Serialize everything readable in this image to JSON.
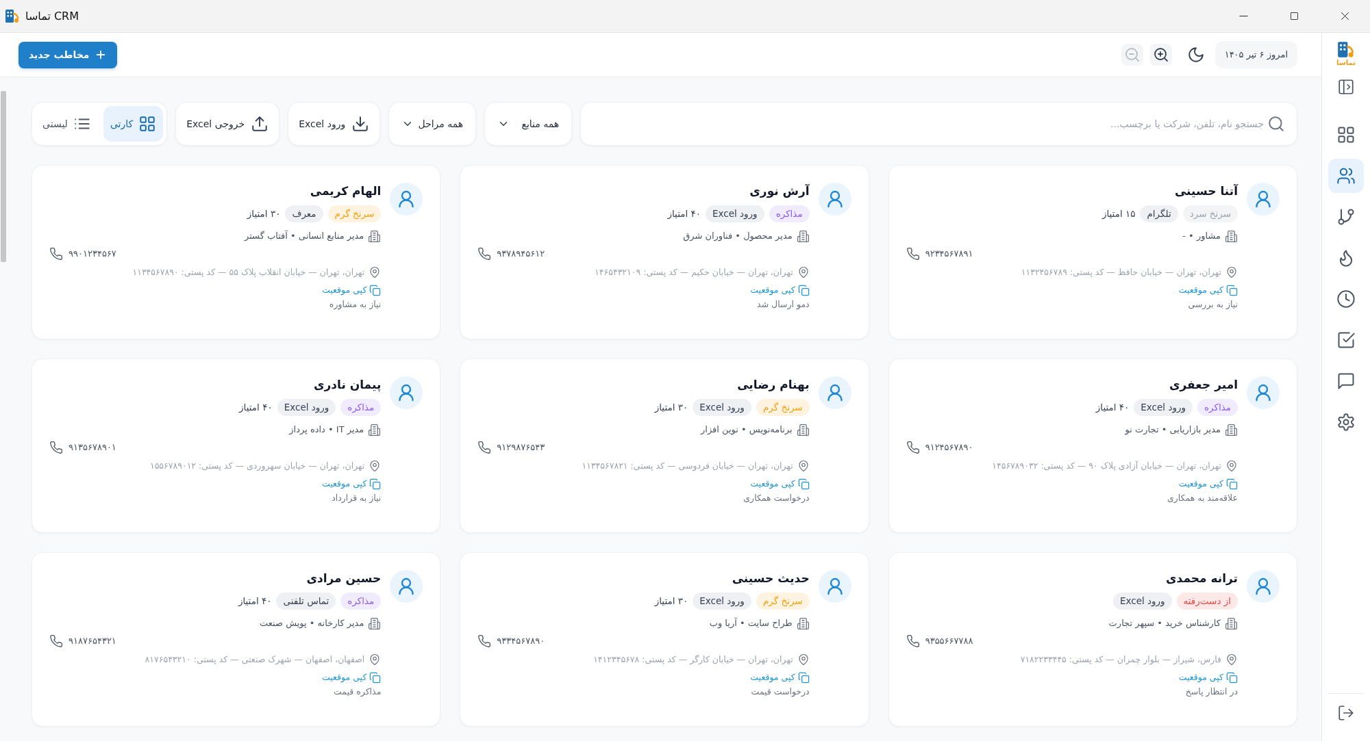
{
  "window": {
    "title": "تماسا CRM"
  },
  "header": {
    "new_contact_button": "مخاطب جدید",
    "zoom_out": {
      "disabled": true
    },
    "zoom_in": {
      "disabled": false
    },
    "date": "امروز ۶ تیر ۱۴۰۵"
  },
  "toolbar": {
    "search": {
      "placeholder": "جستجو نام، تلفن، شرکت یا برچسب..."
    },
    "filters": [
      "همه منابع",
      "همه مراحل"
    ],
    "actions": [
      {
        "label": "ورود Excel",
        "kind": "import"
      },
      {
        "label": "خروجی Excel",
        "kind": "export"
      }
    ],
    "view_modes": [
      {
        "label": "کارتی",
        "kind": "cards",
        "selected": true
      },
      {
        "label": "لیستی",
        "kind": "list",
        "selected": false
      }
    ]
  },
  "contacts": [
    {
      "name": "آتنا حسینی",
      "stage": {
        "label": "سرنخ سرد",
        "color": "#9ca3af"
      },
      "source": "تلگرام",
      "score": "۱۵ امتیاز",
      "role": "مشاور • -",
      "phone": "۹۲۳۴۵۶۷۸۹۱",
      "address": "تهران، تهران — خیابان حافظ — کد پستی: ۱۱۳۲۴۵۶۷۸۹",
      "copy_link": "کپی موقعیت",
      "note": "نیاز به بررسی"
    },
    {
      "name": "آرش نوری",
      "stage": {
        "label": "مذاکره",
        "color": "#8b5cf6"
      },
      "source": "ورود Excel",
      "score": "۴۰ امتیاز",
      "role": "مدیر محصول • فناوران شرق",
      "phone": "۹۳۷۸۹۴۵۶۱۲",
      "address": "تهران، تهران — خیابان حکیم — کد پستی: ۱۴۶۵۴۳۲۱۰۹",
      "copy_link": "کپی موقعیت",
      "note": "دمو ارسال شد"
    },
    {
      "name": "الهام کریمی",
      "stage": {
        "label": "سرنخ گرم",
        "color": "#f59e0b"
      },
      "source": "معرف",
      "score": "۳۰ امتیاز",
      "role": "مدیر منابع انسانی • آفتاب گستر",
      "phone": "۹۹۰۱۲۳۴۵۶۷",
      "address": "تهران، تهران — خیابان انقلاب پلاک ۵۵ — کد پستی: ۱۱۳۴۵۶۷۸۹۰",
      "copy_link": "کپی موقعیت",
      "note": "نیاز به مشاوره"
    },
    {
      "name": "امیر جعفری",
      "stage": {
        "label": "مذاکره",
        "color": "#8b5cf6"
      },
      "source": "ورود Excel",
      "score": "۴۰ امتیاز",
      "role": "مدیر بازاریابی • تجارت نو",
      "phone": "۹۱۲۴۵۶۷۸۹۰",
      "address": "تهران، تهران — خیابان آزادی پلاک ۹۰ — کد پستی: ۱۴۵۶۷۸۹۰۳۲",
      "copy_link": "کپی موقعیت",
      "note": "علاقه‌مند به همکاری"
    },
    {
      "name": "بهنام رضایی",
      "stage": {
        "label": "سرنخ گرم",
        "color": "#f59e0b"
      },
      "source": "ورود Excel",
      "score": "۳۰ امتیاز",
      "role": "برنامه‌نویس • نوین افزار",
      "phone": "۹۱۲۹۸۷۶۵۴۳",
      "address": "تهران، تهران — خیابان فردوسی — کد پستی: ۱۱۳۴۵۶۷۸۲۱",
      "copy_link": "کپی موقعیت",
      "note": "درخواست همکاری"
    },
    {
      "name": "پیمان نادری",
      "stage": {
        "label": "مذاکره",
        "color": "#8b5cf6"
      },
      "source": "ورود Excel",
      "score": "۴۰ امتیاز",
      "role": "مدیر IT • داده پرداز",
      "phone": "۹۱۳۵۶۷۸۹۰۱",
      "address": "تهران، تهران — خیابان سهروردی — کد پستی: ۱۵۵۶۷۸۹۰۱۲",
      "copy_link": "کپی موقعیت",
      "note": "نیاز به قرارداد"
    },
    {
      "name": "ترانه محمدی",
      "stage": {
        "label": "از دست‌رفته",
        "color": "#ef4444"
      },
      "source": "ورود Excel",
      "role": "کارشناس خرید • سپهر تجارت",
      "phone": "۹۳۵۵۶۶۷۷۸۸",
      "address": "فارس، شیراز — بلوار چمران — کد پستی: ۷۱۸۲۲۳۳۴۴۵",
      "copy_link": "کپی موقعیت",
      "note": "در انتظار پاسخ"
    },
    {
      "name": "حدیث حسینی",
      "stage": {
        "label": "سرنخ گرم",
        "color": "#f59e0b"
      },
      "source": "ورود Excel",
      "score": "۳۰ امتیاز",
      "role": "طراح سایت • آریا وب",
      "phone": "۹۳۳۴۵۶۷۸۹۰",
      "address": "تهران، تهران — خیابان کارگر — کد پستی: ۱۴۱۲۳۴۵۶۷۸",
      "copy_link": "کپی موقعیت",
      "note": "درخواست قیمت"
    },
    {
      "name": "حسین مرادی",
      "stage": {
        "label": "مذاکره",
        "color": "#8b5cf6"
      },
      "source": "تماس تلفنی",
      "score": "۴۰ امتیاز",
      "role": "مدیر کارخانه • پویش صنعت",
      "phone": "۹۱۸۷۶۵۴۳۲۱",
      "address": "اصفهان، اصفهان — شهرک صنعتی — کد پستی: ۸۱۷۶۵۴۳۲۱۰",
      "copy_link": "کپی موقعیت",
      "note": "مذاکره قیمت"
    }
  ],
  "sidebar": {
    "logo_text": "تماسا",
    "items": [
      {
        "kind": "grid",
        "selected": false
      },
      {
        "kind": "users",
        "selected": true
      },
      {
        "kind": "branch",
        "selected": false
      },
      {
        "kind": "flame",
        "selected": false
      },
      {
        "kind": "clock",
        "selected": false
      },
      {
        "kind": "checkbox",
        "selected": false
      },
      {
        "kind": "chat",
        "selected": false
      },
      {
        "kind": "gear",
        "selected": false
      }
    ]
  }
}
